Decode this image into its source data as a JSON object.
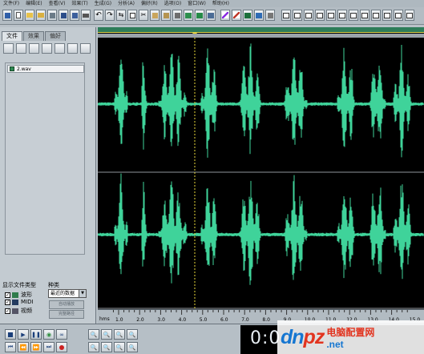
{
  "menubar": {
    "items": [
      "文件(F)",
      "编辑(E)",
      "查看(V)",
      "效果(T)",
      "生成(G)",
      "分析(A)",
      "偏好(R)",
      "选项(O)",
      "窗口(W)",
      "帮助(H)"
    ]
  },
  "panel": {
    "tabs": [
      "文件",
      "效果",
      "偏好"
    ],
    "files": [
      "2.wav"
    ],
    "type_title": "显示文件类型",
    "kind_title": "种类",
    "types": [
      "波形",
      "MIDI",
      "视频"
    ],
    "kind_value": "最近的数据",
    "buttons": [
      "自动播放",
      "完整路径"
    ]
  },
  "ruler": {
    "unit": "hms",
    "ticks": [
      "1.0",
      "2.0",
      "3.0",
      "4.0",
      "5.0",
      "6.0",
      "7.0",
      "8.0",
      "9.0",
      "10.0",
      "11.0",
      "12.0",
      "13.0",
      "14.0",
      "15.0"
    ]
  },
  "time_display": {
    "value": "0:0"
  },
  "watermark": {
    "logo_blue": "dn",
    "logo_red": "pz",
    "suffix": ".net",
    "cn_text": "电脑配置网"
  },
  "colors": {
    "waveform": "#3fd39a",
    "background": "#000000",
    "accent": "#e2341f"
  }
}
